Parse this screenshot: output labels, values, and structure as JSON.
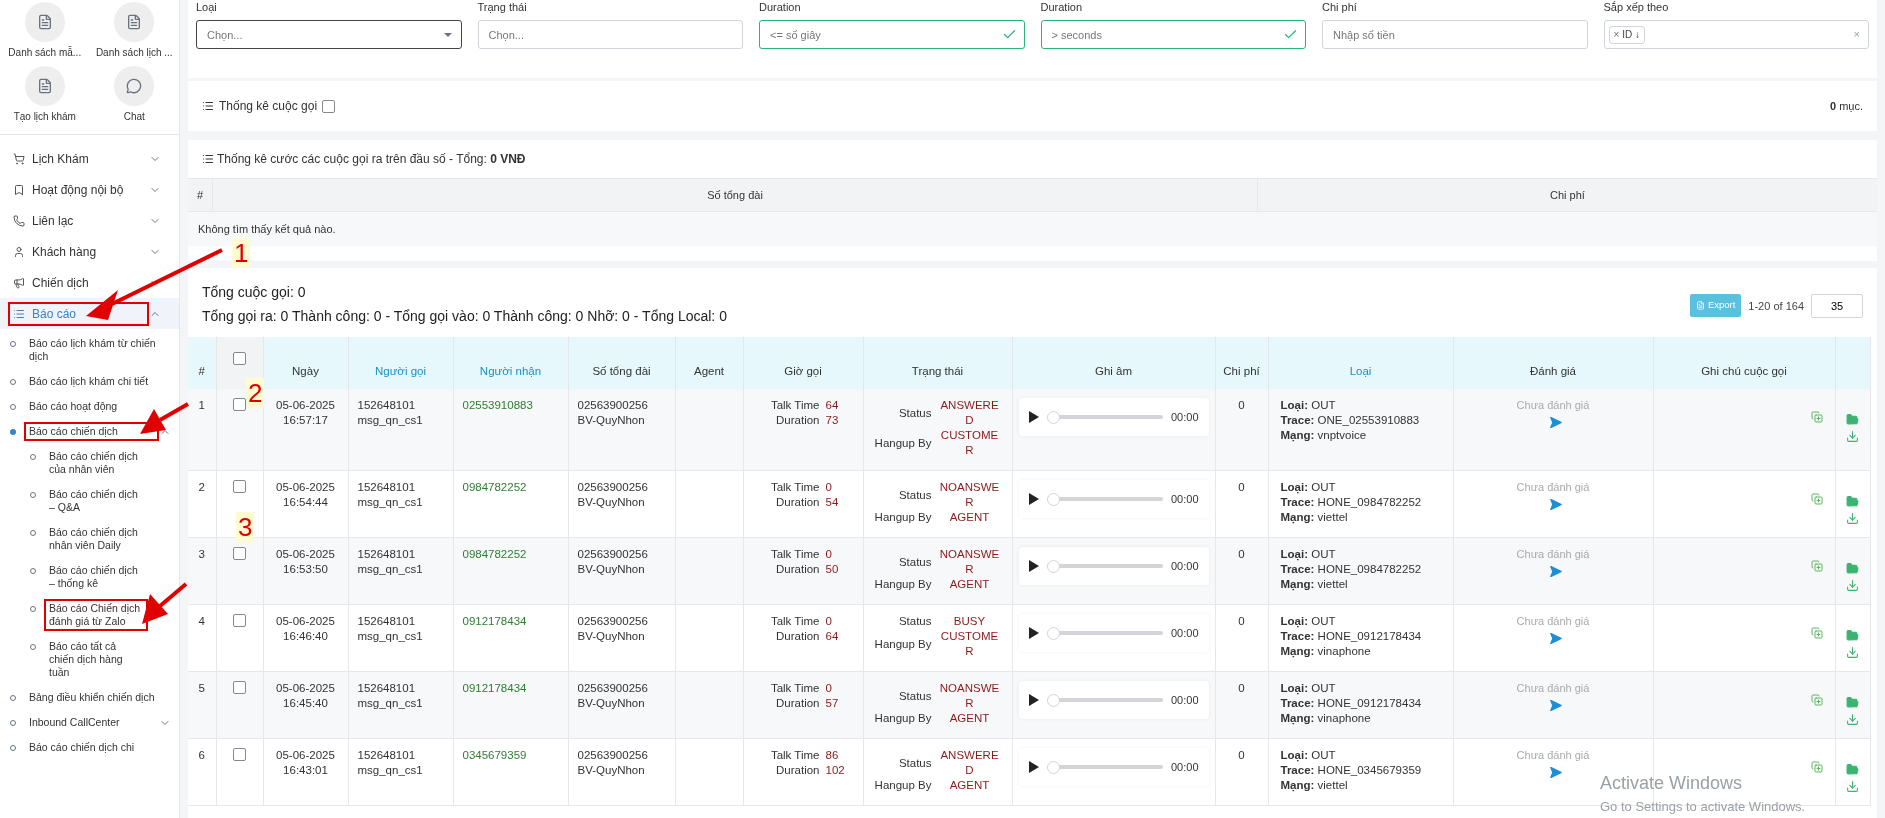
{
  "shortcuts": [
    {
      "label": "Danh sách mẫ..."
    },
    {
      "label": "Danh sách lịch ..."
    },
    {
      "label": "Tạo lịch khám"
    },
    {
      "label": "Chat"
    }
  ],
  "menu": [
    {
      "label": "Lịch Khám",
      "expanded": false,
      "selected": false,
      "highlighted": false
    },
    {
      "label": "Hoạt động nội bộ",
      "expanded": false,
      "selected": false,
      "highlighted": false
    },
    {
      "label": "Liên lạc",
      "expanded": false,
      "selected": false,
      "highlighted": false
    },
    {
      "label": "Khách hàng",
      "expanded": false,
      "selected": false,
      "highlighted": false
    },
    {
      "label": "Chiến dịch",
      "expanded": false,
      "selected": false,
      "highlighted": false
    },
    {
      "label": "Báo cáo",
      "expanded": true,
      "selected": true,
      "highlighted": true,
      "children": [
        {
          "label": "Báo cáo lịch khám từ chiến dịch",
          "selected": false,
          "highlighted": false
        },
        {
          "label": "Báo cáo lịch khám chi tiết",
          "selected": false,
          "highlighted": false
        },
        {
          "label": "Báo cáo hoạt động",
          "selected": false,
          "highlighted": false
        },
        {
          "label": "Báo cáo chiến dịch",
          "selected": true,
          "highlighted": true,
          "expanded": true,
          "children": [
            {
              "label": "Báo cáo chiến dịch của nhân viên",
              "selected": false,
              "highlighted": false
            },
            {
              "label": "Báo cáo chiến dịch – Q&A",
              "selected": false,
              "highlighted": false
            },
            {
              "label": "Báo cáo chiến dịch nhân viên Daily",
              "selected": false,
              "highlighted": false
            },
            {
              "label": "Báo cáo chiến dịch – thống kê",
              "selected": false,
              "highlighted": false
            },
            {
              "label": "Báo cáo Chiến dịch đánh giá từ Zalo",
              "selected": false,
              "highlighted": true
            },
            {
              "label": "Báo cáo tất cả chiến dịch hàng tuần",
              "selected": false,
              "highlighted": false
            }
          ]
        },
        {
          "label": "Bảng điều khiển chiến dịch",
          "selected": false,
          "highlighted": false
        },
        {
          "label": "Inbound CallCenter",
          "selected": false,
          "highlighted": false,
          "expanded": false
        },
        {
          "label": "Báo cáo chiến dịch chi",
          "selected": false,
          "highlighted": false
        }
      ]
    }
  ],
  "filters": [
    {
      "label": "Loại",
      "placeholder": "Chọn...",
      "kind": "select",
      "valid": false,
      "focused": true
    },
    {
      "label": "Trạng thái",
      "placeholder": "Chọn...",
      "kind": "text",
      "valid": false,
      "focused": false
    },
    {
      "label": "Duration",
      "placeholder": "<= số giây",
      "kind": "text",
      "valid": true,
      "focused": false
    },
    {
      "label": "Duration",
      "placeholder": "> seconds",
      "kind": "text",
      "valid": true,
      "focused": false
    },
    {
      "label": "Chi phí",
      "placeholder": "Nhập số tiền",
      "kind": "text",
      "valid": false,
      "focused": false
    },
    {
      "label": "Sắp xếp theo",
      "kind": "tags",
      "tags": [
        "ID ↓"
      ],
      "tag_remove": "×",
      "clear": "×"
    }
  ],
  "call_stats": {
    "title": "Thống kê cuộc gọi",
    "checked": false,
    "count": "**0** mục."
  },
  "cost_stats": {
    "title": "Thống kê cước các cuộc gọi ra trên đầu số - Tổng: **0 VNĐ**",
    "columns": [
      "#",
      "Số tổng đài",
      "Chi phí"
    ],
    "empty": "Không tìm thấy kết quả nào."
  },
  "summary": {
    "total": "Tổng cuộc gọi: 0",
    "detail": "Tổng gọi ra: 0 Thành công: 0 - Tổng gọi vào: 0 Thành công: 0 Nhỡ: 0 - Tổng Local: 0"
  },
  "pagination": {
    "export": "Export",
    "range": "1-20 of 164",
    "page_size": "35"
  },
  "table": {
    "header_checked": false,
    "columns": [
      {
        "label": "#",
        "sortable": false
      },
      {},
      {
        "label": "Ngày",
        "sortable": false
      },
      {
        "label": "Người gọi",
        "sortable": true
      },
      {
        "label": "Người nhận",
        "sortable": true
      },
      {
        "label": "Số tổng đài",
        "sortable": false
      },
      {
        "label": "Agent",
        "sortable": false
      },
      {
        "label": "Giờ gọi",
        "sortable": false
      },
      {
        "label": "Trạng thái",
        "sortable": false
      },
      {
        "label": "Ghi âm",
        "sortable": false
      },
      {
        "label": "Chi phí",
        "sortable": false
      },
      {
        "label": "Loại",
        "sortable": true
      },
      {
        "label": "Đánh giá",
        "sortable": false
      },
      {
        "label": "Ghi chú cuộc gọi",
        "sortable": false
      },
      {}
    ],
    "rows": [
      {
        "no": "1",
        "checked": false,
        "date": "05-06-2025",
        "time": "16:57:17",
        "caller_id": "152648101",
        "caller_name": "msg_qn_cs1",
        "callee": "02553910883",
        "trunk": "02563900256",
        "trunk_name": "BV-QuyNhon",
        "talk_label": "Talk Time",
        "talk": "64",
        "duration_label": "Duration",
        "duration": "73",
        "status_label": "Status",
        "status": "ANSWERED",
        "hangup_label": "Hangup By",
        "hangup": "CUSTOMER",
        "audio_time": "00:00",
        "level": 0,
        "cost": "0",
        "type_label": "Loại:",
        "type": "OUT",
        "trace_label": "Trace:",
        "trace": "ONE_02553910883",
        "network_label": "Mạng:",
        "network": "vnptvoice",
        "rating": "Chưa đánh giá"
      },
      {
        "no": "2",
        "checked": false,
        "date": "05-06-2025",
        "time": "16:54:44",
        "caller_id": "152648101",
        "caller_name": "msg_qn_cs1",
        "callee": "0984782252",
        "trunk": "02563900256",
        "trunk_name": "BV-QuyNhon",
        "talk_label": "Talk Time",
        "talk": "0",
        "duration_label": "Duration",
        "duration": "54",
        "status_label": "Status",
        "status": "NOANSWER",
        "hangup_label": "Hangup By",
        "hangup": "AGENT",
        "audio_time": "00:00",
        "level": 0,
        "cost": "0",
        "type_label": "Loại:",
        "type": "OUT",
        "trace_label": "Trace:",
        "trace": "HONE_0984782252",
        "network_label": "Mạng:",
        "network": "viettel",
        "rating": "Chưa đánh giá"
      },
      {
        "no": "3",
        "checked": false,
        "date": "05-06-2025",
        "time": "16:53:50",
        "caller_id": "152648101",
        "caller_name": "msg_qn_cs1",
        "callee": "0984782252",
        "trunk": "02563900256",
        "trunk_name": "BV-QuyNhon",
        "talk_label": "Talk Time",
        "talk": "0",
        "duration_label": "Duration",
        "duration": "50",
        "status_label": "Status",
        "status": "NOANSWER",
        "hangup_label": "Hangup By",
        "hangup": "AGENT",
        "audio_time": "00:00",
        "level": 0,
        "cost": "0",
        "type_label": "Loại:",
        "type": "OUT",
        "trace_label": "Trace:",
        "trace": "HONE_0984782252",
        "network_label": "Mạng:",
        "network": "viettel",
        "rating": "Chưa đánh giá"
      },
      {
        "no": "4",
        "checked": false,
        "date": "05-06-2025",
        "time": "16:46:40",
        "caller_id": "152648101",
        "caller_name": "msg_qn_cs1",
        "callee": "0912178434",
        "trunk": "02563900256",
        "trunk_name": "BV-QuyNhon",
        "talk_label": "Talk Time",
        "talk": "0",
        "duration_label": "Duration",
        "duration": "64",
        "status_label": "Status",
        "status": "BUSY",
        "hangup_label": "Hangup By",
        "hangup": "CUSTOMER",
        "audio_time": "00:00",
        "level": 0,
        "cost": "0",
        "type_label": "Loại:",
        "type": "OUT",
        "trace_label": "Trace:",
        "trace": "HONE_0912178434",
        "network_label": "Mạng:",
        "network": "vinaphone",
        "rating": "Chưa đánh giá"
      },
      {
        "no": "5",
        "checked": false,
        "date": "05-06-2025",
        "time": "16:45:40",
        "caller_id": "152648101",
        "caller_name": "msg_qn_cs1",
        "callee": "0912178434",
        "trunk": "02563900256",
        "trunk_name": "BV-QuyNhon",
        "talk_label": "Talk Time",
        "talk": "0",
        "duration_label": "Duration",
        "duration": "57",
        "status_label": "Status",
        "status": "NOANSWER",
        "hangup_label": "Hangup By",
        "hangup": "AGENT",
        "audio_time": "00:00",
        "level": 0,
        "cost": "0",
        "type_label": "Loại:",
        "type": "OUT",
        "trace_label": "Trace:",
        "trace": "HONE_0912178434",
        "network_label": "Mạng:",
        "network": "vinaphone",
        "rating": "Chưa đánh giá"
      },
      {
        "no": "6",
        "checked": false,
        "date": "05-06-2025",
        "time": "16:43:01",
        "caller_id": "152648101",
        "caller_name": "msg_qn_cs1",
        "callee": "0345679359",
        "trunk": "02563900256",
        "trunk_name": "BV-QuyNhon",
        "talk_label": "Talk Time",
        "talk": "86",
        "duration_label": "Duration",
        "duration": "102",
        "status_label": "Status",
        "status": "ANSWERED",
        "hangup_label": "Hangup By",
        "hangup": "AGENT",
        "audio_time": "00:00",
        "level": 0,
        "cost": "0",
        "type_label": "Loại:",
        "type": "OUT",
        "trace_label": "Trace:",
        "trace": "HONE_0345679359",
        "network_label": "Mạng:",
        "network": "viettel",
        "rating": "Chưa đánh giá"
      }
    ]
  },
  "annotations": [
    {
      "label": "1"
    },
    {
      "label": "2"
    },
    {
      "label": "3"
    }
  ],
  "os_notice": {
    "title": "Activate Windows",
    "subtitle": "Go to Settings to activate Windows."
  }
}
